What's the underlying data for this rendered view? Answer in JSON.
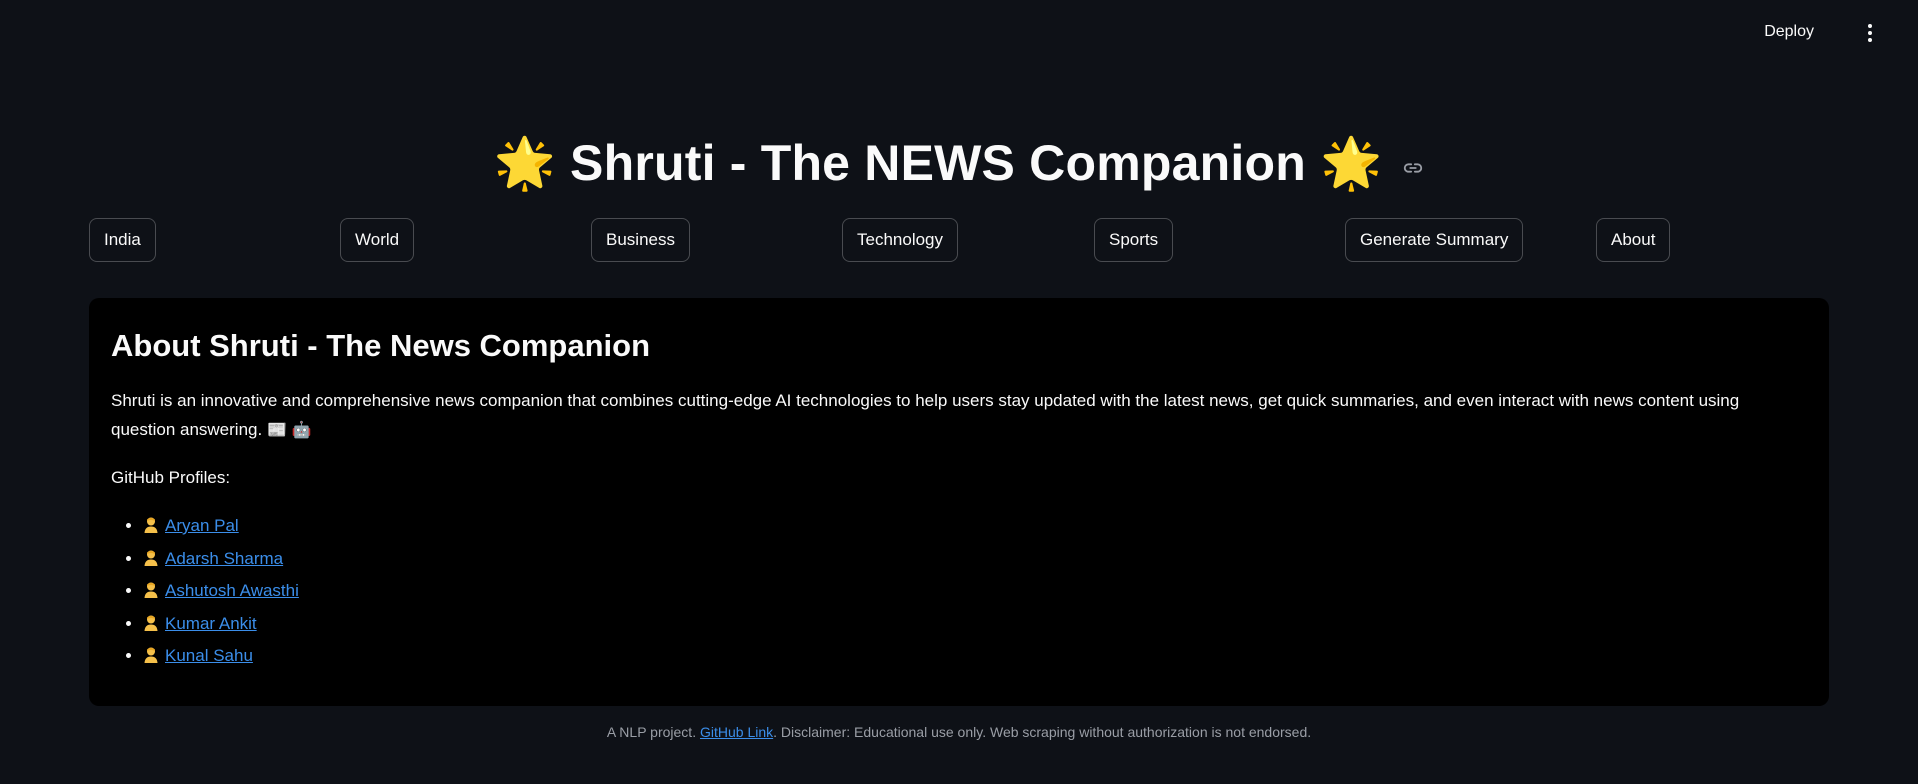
{
  "header": {
    "deploy_label": "Deploy",
    "menu_icon": "vertical-ellipsis-icon"
  },
  "title": {
    "left_icon": "glowing-star-icon",
    "star_glyph": "🌟",
    "text": "Shruti - The NEWS Companion",
    "right_icon": "glowing-star-icon",
    "link_icon": "link-icon"
  },
  "nav": {
    "items": [
      {
        "label": "India"
      },
      {
        "label": "World"
      },
      {
        "label": "Business"
      },
      {
        "label": "Technology"
      },
      {
        "label": "Sports"
      },
      {
        "label": "Generate Summary"
      },
      {
        "label": "About"
      }
    ]
  },
  "about": {
    "heading": "About Shruti - The News Companion",
    "description": "Shruti is an innovative and comprehensive news companion that combines cutting-edge AI technologies to help users stay updated with the latest news, get quick summaries, and even interact with news content using question answering.",
    "description_icons": [
      "newspaper-icon",
      "robot-icon"
    ],
    "newspaper_glyph": "📰",
    "robot_glyph": "🤖",
    "github_label": "GitHub Profiles:",
    "profiles": [
      {
        "name": "Aryan Pal",
        "icon": "person-icon"
      },
      {
        "name": "Adarsh Sharma",
        "icon": "person-icon"
      },
      {
        "name": "Ashutosh Awasthi",
        "icon": "person-icon"
      },
      {
        "name": "Kumar Ankit",
        "icon": "person-icon"
      },
      {
        "name": "Kunal Sahu",
        "icon": "person-icon"
      }
    ]
  },
  "footer": {
    "prefix": "A NLP project.",
    "link_label": "GitHub Link",
    "suffix": ". Disclaimer: Educational use only. Web scraping without authorization is not endorsed."
  },
  "colors": {
    "background": "#0e1117",
    "card": "#000000",
    "text": "#fafafa",
    "link": "#3b8eea",
    "star": "#f7c62f",
    "footer_text": "#9a9ea6"
  }
}
